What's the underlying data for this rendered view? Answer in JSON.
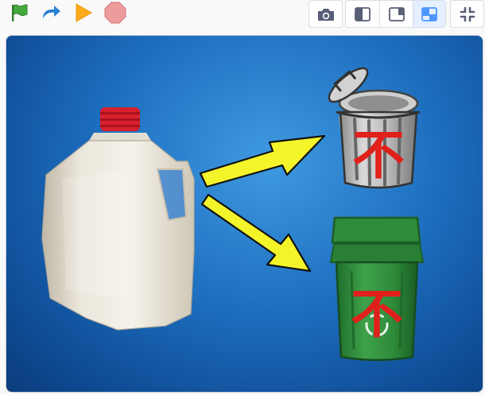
{
  "toolbar": {
    "left_buttons": [
      {
        "name": "green-flag-icon",
        "color": "#2e9e3b"
      },
      {
        "name": "redo-icon",
        "color": "#2a7fd4"
      },
      {
        "name": "play-icon",
        "color": "#ffab19"
      },
      {
        "name": "stop-icon",
        "color": "#ec9c9c"
      }
    ],
    "right_buttons": [
      {
        "name": "camera-icon"
      },
      {
        "name": "small-stage-icon"
      },
      {
        "name": "normal-stage-icon"
      },
      {
        "name": "layout-icon",
        "active": true
      },
      {
        "name": "fullscreen-icon"
      }
    ]
  },
  "stage": {
    "background_color": "#1e6fc0",
    "sprites": [
      {
        "name": "milk-jug",
        "cap_color": "#d91f2c"
      },
      {
        "name": "arrow-to-trash",
        "color": "#f4f42a"
      },
      {
        "name": "arrow-to-recycle",
        "color": "#f4f42a"
      },
      {
        "name": "trash-can",
        "label": "不",
        "label_color": "#e0201b"
      },
      {
        "name": "recycle-bin",
        "label": "不",
        "label_color": "#e0201b",
        "color": "#2e8b3a"
      }
    ]
  }
}
